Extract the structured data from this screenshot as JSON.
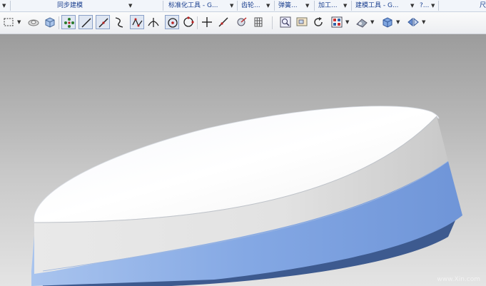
{
  "ribbon": {
    "groups": [
      {
        "label": "同步建模"
      },
      {
        "label": "标准化工具 - G..."
      },
      {
        "label": "齿轮..."
      },
      {
        "label": "弹簧..."
      },
      {
        "label": "加工..."
      },
      {
        "label": "建模工具 - G..."
      },
      {
        "label": "?..."
      },
      {
        "label": "尺"
      }
    ]
  },
  "toolbar": {
    "icons": [
      {
        "name": "select-box-icon"
      },
      {
        "name": "sketch-icon"
      },
      {
        "name": "solid-cube-icon"
      },
      {
        "name": "snap-points-icon",
        "active": true
      },
      {
        "name": "line-icon",
        "active": true
      },
      {
        "name": "line-endpoint-icon",
        "active": true
      },
      {
        "name": "curve-icon"
      },
      {
        "name": "polyline-icon",
        "active": true
      },
      {
        "name": "intersection-icon"
      },
      {
        "name": "center-point-icon",
        "active": true
      },
      {
        "name": "circle-point-icon"
      },
      {
        "name": "crosshair-icon"
      },
      {
        "name": "tangent-line-icon"
      },
      {
        "name": "measure-icon"
      },
      {
        "name": "grid-icon"
      },
      {
        "name": "zoom-fit-icon"
      },
      {
        "name": "view-frame-icon"
      },
      {
        "name": "rotate-icon"
      },
      {
        "name": "layout-icon"
      },
      {
        "name": "shaded-view-icon"
      },
      {
        "name": "cube-view-icon"
      },
      {
        "name": "display-mode-icon"
      }
    ]
  },
  "viewport": {
    "background_top": "#9c9c9c",
    "background_bottom": "#e4e4e4",
    "top_face_color": "#ffffff",
    "side_face_color": "#e4e4e4",
    "blue_band_color": "#7da2e0",
    "dark_bottom_color": "#3d5a8f"
  },
  "watermark": "www.Xin.com"
}
